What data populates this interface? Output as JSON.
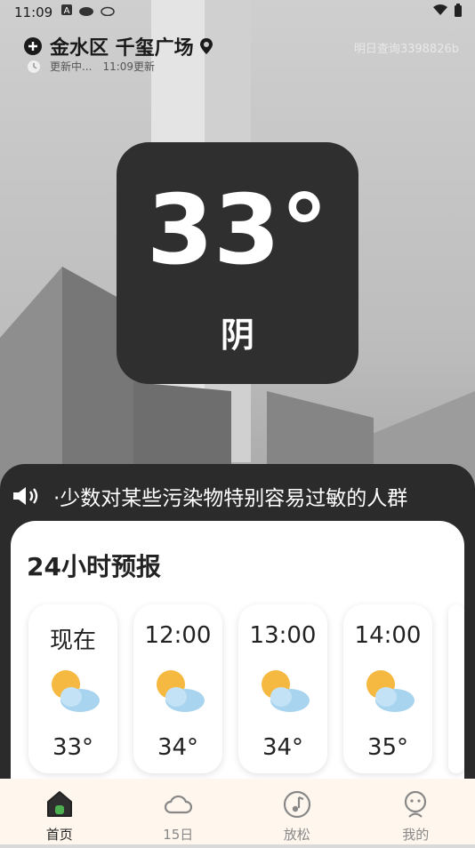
{
  "status_bar": {
    "time": "11:09"
  },
  "header": {
    "location": "金水区 千玺广场",
    "update_status": "更新中...",
    "update_time": "11:09更新",
    "promo": "明日查询3398826b"
  },
  "current": {
    "temperature": "33°",
    "condition": "阴"
  },
  "ticker": {
    "text": "·少数对某些污染物特别容易过敏的人群"
  },
  "forecast": {
    "title": "24小时预报",
    "hours": [
      {
        "time": "现在",
        "icon": "partly-cloudy-icon",
        "temp": "33°"
      },
      {
        "time": "12:00",
        "icon": "partly-cloudy-icon",
        "temp": "34°"
      },
      {
        "time": "13:00",
        "icon": "partly-cloudy-icon",
        "temp": "34°"
      },
      {
        "time": "14:00",
        "icon": "partly-cloudy-icon",
        "temp": "35°"
      }
    ]
  },
  "tabs": [
    {
      "label": "首页",
      "icon": "home-icon",
      "active": true
    },
    {
      "label": "15日",
      "icon": "cloud-icon",
      "active": false
    },
    {
      "label": "放松",
      "icon": "music-note-icon",
      "active": false
    },
    {
      "label": "我的",
      "icon": "profile-face-icon",
      "active": false
    }
  ],
  "colors": {
    "card_dark": "#2f2f2f",
    "panel_dark": "#2b2b2b",
    "tabbar_bg": "#fff7ee",
    "sun": "#f5b942",
    "cloud": "#a8d4ef"
  }
}
